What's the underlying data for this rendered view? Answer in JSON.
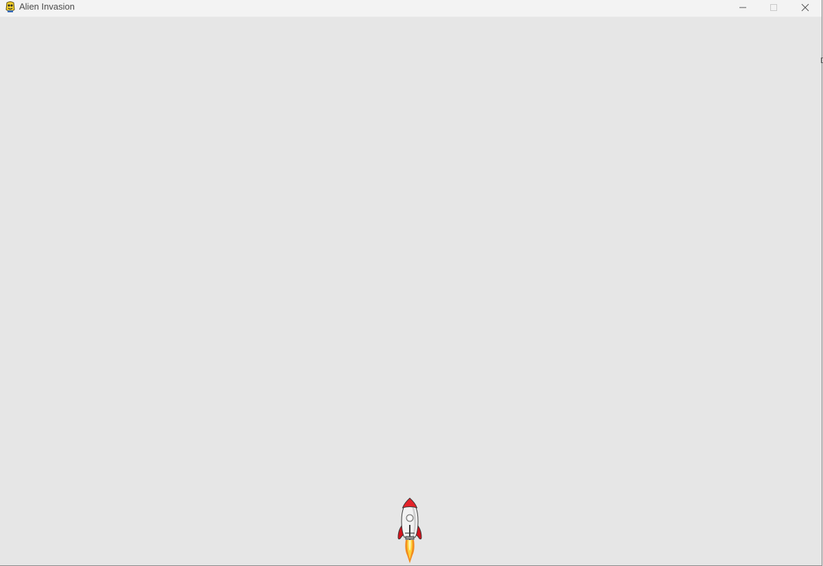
{
  "window": {
    "title": "Alien Invasion",
    "icon": "pygame-snake-icon",
    "controls": {
      "minimize_icon": "minimize-icon",
      "maximize_icon": "maximize-icon",
      "close_icon": "close-icon"
    }
  },
  "game": {
    "background_color": "#e6e6e6",
    "ship": {
      "icon": "rocket-ship-icon",
      "colors": {
        "nose": "#e3232a",
        "body": "#f2f2f2",
        "fins": "#d3141d",
        "flame_outer": "#f28c1f",
        "flame_inner": "#ffd23a"
      }
    }
  }
}
